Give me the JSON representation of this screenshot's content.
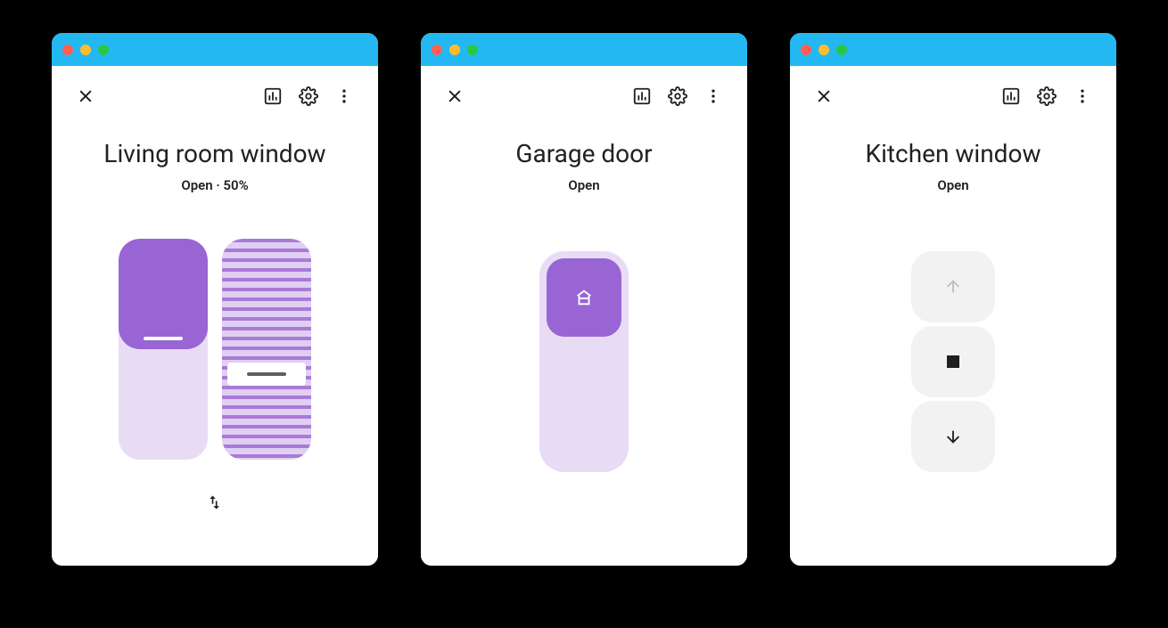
{
  "cards": [
    {
      "title": "Living room window",
      "status": "Open · 50%",
      "cover_percent": 50
    },
    {
      "title": "Garage door",
      "status": "Open"
    },
    {
      "title": "Kitchen window",
      "status": "Open"
    }
  ]
}
